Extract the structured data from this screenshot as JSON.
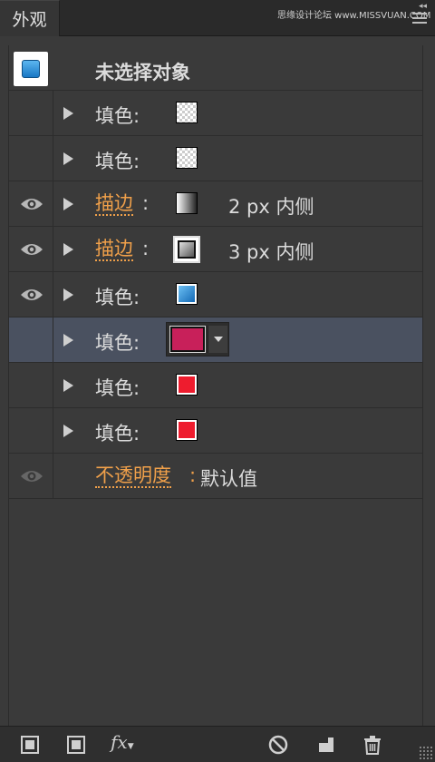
{
  "tab": {
    "title": "外观"
  },
  "watermark": "思缘设计论坛 www.MISSVUAN.COM",
  "header": {
    "label": "未选择对象"
  },
  "rows": [
    {
      "label": "填色:",
      "swatch": "checker"
    },
    {
      "label": "填色:",
      "swatch": "checker"
    },
    {
      "label": "描边",
      "colon": ":",
      "swatch": "gradient-bw",
      "detail": "2 px  内侧"
    },
    {
      "label": "描边",
      "colon": ":",
      "swatch": "gradient-gray",
      "detail": "3 px  内侧"
    },
    {
      "label": "填色:",
      "swatch": "gradient-blue"
    },
    {
      "label": "填色:",
      "swatch": "#c8205a"
    },
    {
      "label": "填色:",
      "swatch": "#ee1c2e"
    },
    {
      "label": "填色:",
      "swatch": "#ee1c2e"
    }
  ],
  "opacity": {
    "label": "不透明度",
    "colon": ":",
    "value": "默认值"
  },
  "colors": {
    "accent_link": "#f0a04a",
    "selected_row": "#4a5160",
    "panel_bg": "#3a3a3a",
    "red": "#ee1c2e",
    "magenta": "#c8205a"
  },
  "toolbar": {
    "icons": [
      "add-stroke-icon",
      "add-fill-icon",
      "fx-icon",
      "clear-appearance-icon",
      "duplicate-item-icon",
      "delete-item-icon"
    ],
    "fx_label": "fx"
  }
}
